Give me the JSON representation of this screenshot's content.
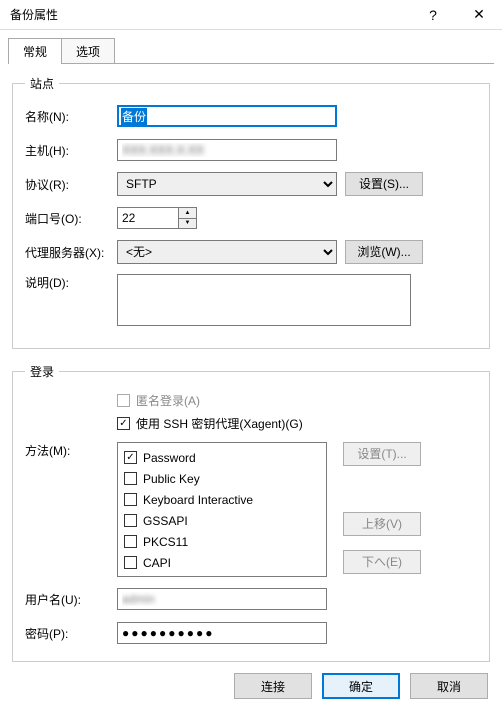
{
  "titlebar": {
    "title": "备份属性"
  },
  "tabs": {
    "general": "常规",
    "options": "选项"
  },
  "site": {
    "legend": "站点",
    "name_label": "名称(N):",
    "name_value": "备份",
    "host_label": "主机(H):",
    "host_value": "XXX.XXX.X.XX",
    "protocol_label": "协议(R):",
    "protocol_value": "SFTP",
    "settings_btn": "设置(S)...",
    "port_label": "端口号(O):",
    "port_value": "22",
    "proxy_label": "代理服务器(X):",
    "proxy_value": "<无>",
    "browse_btn": "浏览(W)...",
    "desc_label": "说明(D):",
    "desc_value": ""
  },
  "login": {
    "legend": "登录",
    "anon": "匿名登录(A)",
    "use_ssh_agent": "使用 SSH 密钥代理(Xagent)(G)",
    "method_label": "方法(M):",
    "methods": [
      {
        "label": "Password",
        "checked": true
      },
      {
        "label": "Public Key",
        "checked": false
      },
      {
        "label": "Keyboard Interactive",
        "checked": false
      },
      {
        "label": "GSSAPI",
        "checked": false
      },
      {
        "label": "PKCS11",
        "checked": false
      },
      {
        "label": "CAPI",
        "checked": false
      }
    ],
    "settings_btn": "设置(T)...",
    "move_up_btn": "上移(V)",
    "move_down_btn": "下へ(E)",
    "user_label": "用户名(U):",
    "user_value": "admin",
    "pass_label": "密码(P):",
    "pass_value": "●●●●●●●●●●"
  },
  "footer": {
    "connect": "连接",
    "ok": "确定",
    "cancel": "取消"
  }
}
